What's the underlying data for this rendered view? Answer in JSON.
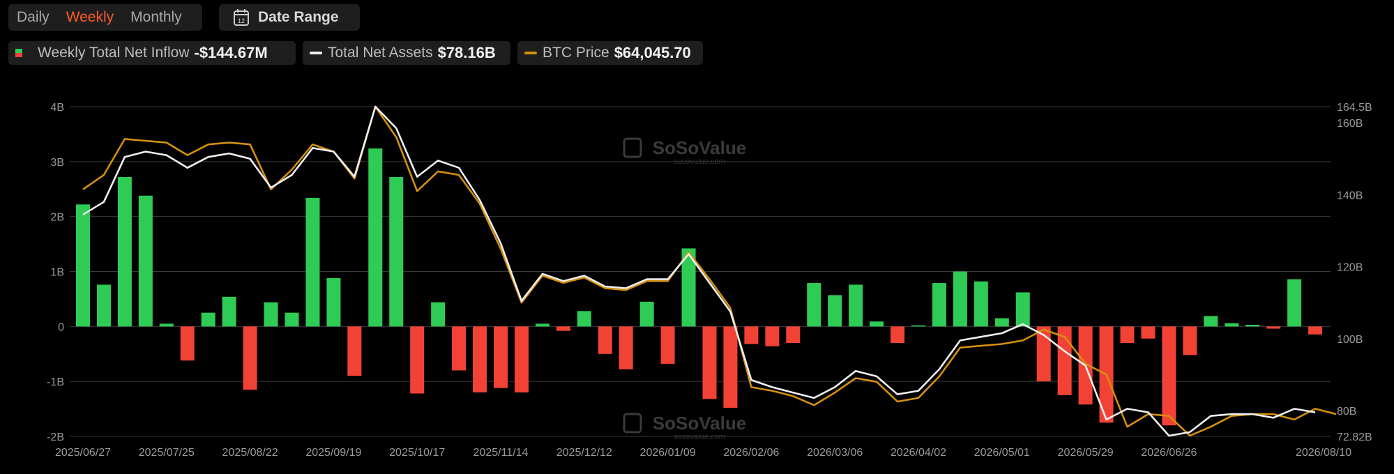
{
  "toolbar": {
    "periods": [
      "Daily",
      "Weekly",
      "Monthly"
    ],
    "active_period": "Weekly",
    "date_range_label": "Date Range",
    "calendar_icon_day": "12"
  },
  "legend": {
    "inflow": {
      "label": "Weekly Total Net Inflow",
      "value": "-$144.67M"
    },
    "assets": {
      "label": "Total Net Assets",
      "value": "$78.16B"
    },
    "btc": {
      "label": "BTC Price",
      "value": "$64,045.70"
    }
  },
  "colors": {
    "positive": "#2ecc55",
    "negative": "#f24236",
    "assets_line": "#f0f0f0",
    "btc_line": "#d4900c",
    "grid": "#3a3a3a",
    "accent": "#ff5a2c"
  },
  "watermark": {
    "name": "SoSoValue",
    "url": "sosovalue.com"
  },
  "chart_data": {
    "type": "bar",
    "title": "",
    "y_left": {
      "ticks": [
        "4B",
        "3B",
        "2B",
        "1B",
        "0",
        "-1B",
        "-2B"
      ],
      "ylim": [
        -2,
        4
      ],
      "unit": "B"
    },
    "y_right": {
      "ticks": [
        "164.5B",
        "160B",
        "140B",
        "120B",
        "100B",
        "80B",
        "72.82B"
      ],
      "ylim": [
        72.82,
        164.5
      ],
      "unit": "B"
    },
    "x_tick_labels": [
      "2025/06/27",
      "2025/07/25",
      "2025/08/22",
      "2025/09/19",
      "2025/10/17",
      "2025/11/14",
      "2025/12/12",
      "2026/01/09",
      "2026/02/06",
      "2026/03/06",
      "2026/04/02",
      "2026/05/01",
      "2026/05/29",
      "2026/06/26",
      "2026/08/10"
    ],
    "x_tick_index": [
      0,
      4,
      8,
      12,
      16,
      20,
      24,
      28,
      32,
      36,
      40,
      44,
      48,
      52,
      60
    ],
    "grid": true,
    "legend_position": "top-left",
    "series": [
      {
        "name": "Weekly Total Net Inflow",
        "type": "bar",
        "axis": "left",
        "unit": "B",
        "values": [
          2.22,
          0.76,
          2.72,
          2.38,
          0.05,
          -0.62,
          0.25,
          0.54,
          -1.15,
          0.44,
          0.25,
          2.34,
          0.88,
          -0.9,
          3.24,
          2.72,
          -1.22,
          0.44,
          -0.8,
          -1.2,
          -1.12,
          -1.2,
          0.05,
          -0.08,
          0.28,
          -0.5,
          -0.78,
          0.45,
          -0.68,
          1.42,
          -1.32,
          -1.48,
          -0.32,
          -0.36,
          -0.3,
          0.79,
          0.57,
          0.76,
          0.09,
          -0.3,
          0.02,
          0.79,
          1.0,
          0.82,
          0.15,
          0.62,
          -1.0,
          -1.25,
          -1.42,
          -1.75,
          -0.3,
          -0.22,
          -1.8,
          -0.52,
          0.19,
          0.06,
          0.03,
          -0.04,
          0.86,
          -0.145
        ]
      },
      {
        "name": "Total Net Assets",
        "type": "line",
        "axis": "right",
        "unit": "B",
        "values": [
          134.5,
          138,
          150.5,
          152,
          151,
          147.5,
          150.5,
          151.5,
          150,
          142,
          145.5,
          153,
          152,
          145,
          164.5,
          158.5,
          145,
          149.5,
          147.5,
          138.5,
          126.5,
          110.5,
          118,
          116,
          117.5,
          114.5,
          114,
          116.5,
          116.5,
          123.5,
          115.5,
          107.5,
          88.5,
          86.5,
          85,
          83.5,
          86.5,
          91,
          89.5,
          84.5,
          85.5,
          91.5,
          99.5,
          100.5,
          101.5,
          104,
          101,
          96.5,
          92.5,
          77.5,
          80.5,
          79.5,
          73,
          74,
          78.5,
          79,
          79,
          78,
          80.5,
          79.5
        ]
      },
      {
        "name": "BTC Price",
        "type": "line",
        "axis": "right",
        "unit": "B",
        "values": [
          141.5,
          145.5,
          155.5,
          155,
          154.5,
          151,
          154,
          154.5,
          154,
          141.5,
          147,
          154,
          152,
          144.5,
          164.5,
          156,
          141,
          146.5,
          145.5,
          137.5,
          125,
          110,
          117.5,
          115.5,
          117,
          114,
          113.5,
          116,
          116,
          124,
          116.5,
          108.5,
          86.5,
          85.5,
          84,
          81.5,
          85,
          89,
          88,
          82.5,
          83.5,
          89.5,
          97.5,
          98,
          98.5,
          99.5,
          102.5,
          100.5,
          93,
          90,
          75.5,
          79,
          78.5,
          73,
          75.5,
          78.5,
          79,
          79,
          77.5,
          80.5,
          79
        ]
      }
    ]
  }
}
